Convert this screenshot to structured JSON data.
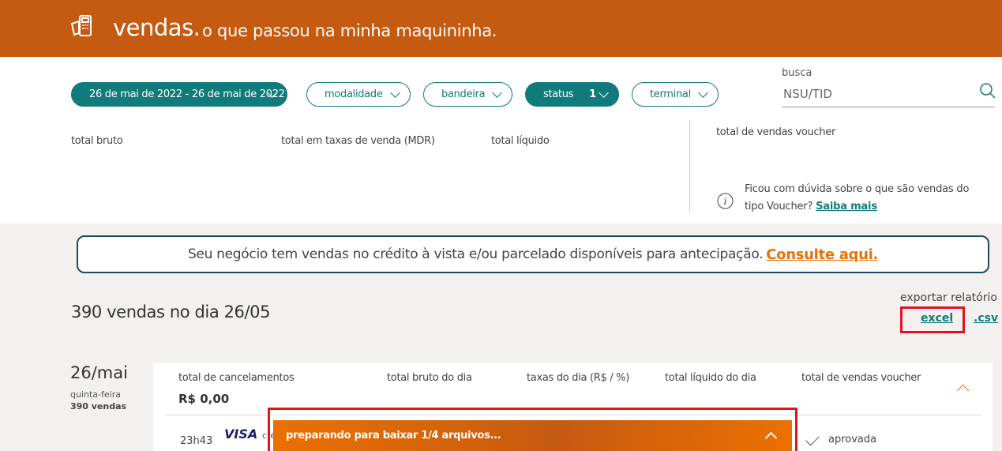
{
  "header": {
    "title": "vendas.",
    "subtitle": "o que passou na minha maquininha."
  },
  "filters": {
    "date_range": "26 de mai de 2022 - 26 de mai de 2022",
    "modalidade": "modalidade",
    "bandeira": "bandeira",
    "status": "status",
    "status_badge": "1",
    "terminal": "terminal"
  },
  "search": {
    "label": "busca",
    "placeholder": "NSU/TID"
  },
  "summary": {
    "total_bruto": "total bruto",
    "total_taxas": "total em taxas de venda (MDR)",
    "total_liquido": "total líquido",
    "total_voucher": "total de vendas voucher",
    "info_text": "Ficou com dúvida sobre o que são vendas do tipo Voucher?",
    "info_link": "Saiba mais"
  },
  "banner": {
    "text": "Seu negócio tem vendas no crédito à vista e/ou parcelado disponíveis para antecipação.",
    "link": "Consulte aqui."
  },
  "sales": {
    "count_text": "390 vendas no dia 26/05"
  },
  "export": {
    "label": "exportar relatório",
    "excel": "excel",
    "csv": ".csv"
  },
  "day": {
    "date": "26/mai",
    "weekday": "quinta-feira",
    "count": "390 vendas",
    "cards": {
      "cancelamentos_label": "total de cancelamentos",
      "cancelamentos_value": "R$ 0,00",
      "bruto_label": "total bruto do dia",
      "taxas_label": "taxas do dia (R$ / %)",
      "liquido_label": "total líquido do dia",
      "voucher_label": "total de vendas voucher"
    },
    "transaction": {
      "time": "23h43",
      "brand": "VISA",
      "type": "cré",
      "status": "aprovada"
    }
  },
  "download": {
    "text": "preparando para baixar 1/4 arquivos..."
  },
  "colors": {
    "brand_orange": "#ec7000",
    "header_orange": "#c55a11",
    "teal": "#117a7a",
    "highlight_red": "#e0141e"
  }
}
